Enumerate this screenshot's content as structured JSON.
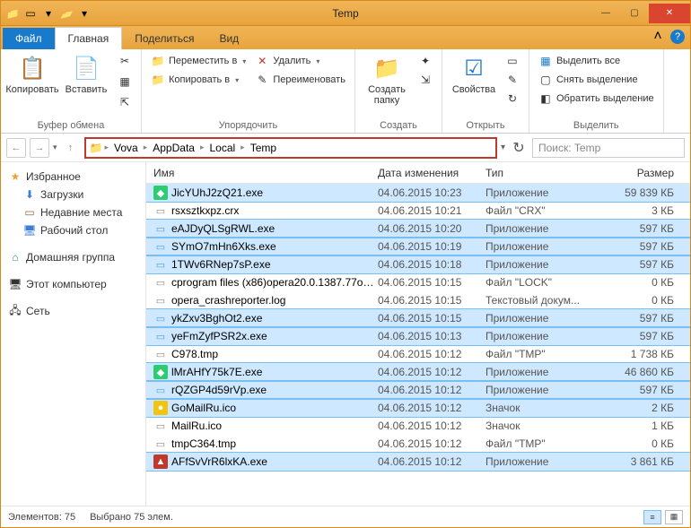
{
  "title": "Temp",
  "tabs": {
    "file": "Файл",
    "main": "Главная",
    "share": "Поделиться",
    "view": "Вид"
  },
  "ribbon": {
    "clipboard": {
      "copy": "Копировать",
      "paste": "Вставить",
      "label": "Буфер обмена"
    },
    "organize": {
      "moveTo": "Переместить в",
      "copyTo": "Копировать в",
      "delete": "Удалить",
      "rename": "Переименовать",
      "label": "Упорядочить"
    },
    "new": {
      "newFolder": "Создать папку",
      "label": "Создать"
    },
    "open": {
      "properties": "Свойства",
      "label": "Открыть"
    },
    "select": {
      "selectAll": "Выделить все",
      "selectNone": "Снять выделение",
      "invert": "Обратить выделение",
      "label": "Выделить"
    }
  },
  "breadcrumb": {
    "seg1": "Vova",
    "seg2": "AppData",
    "seg3": "Local",
    "seg4": "Temp"
  },
  "searchPlaceholder": "Поиск: Temp",
  "sidebar": {
    "favorites": "Избранное",
    "downloads": "Загрузки",
    "recent": "Недавние места",
    "desktop": "Рабочий стол",
    "homegroup": "Домашняя группа",
    "thispc": "Этот компьютер",
    "network": "Сеть"
  },
  "columns": {
    "name": "Имя",
    "date": "Дата изменения",
    "type": "Тип",
    "size": "Размер"
  },
  "files": [
    {
      "ic": "green",
      "name": "JicYUhJ2zQ21.exe",
      "date": "04.06.2015 10:23",
      "type": "Приложение",
      "size": "59 839 КБ",
      "sel": true
    },
    {
      "ic": "file",
      "name": "rsxsztkxpz.crx",
      "date": "04.06.2015 10:21",
      "type": "Файл \"CRX\"",
      "size": "3 КБ",
      "sel": false
    },
    {
      "ic": "app",
      "name": "eAJDyQLSgRWL.exe",
      "date": "04.06.2015 10:20",
      "type": "Приложение",
      "size": "597 КБ",
      "sel": true
    },
    {
      "ic": "app",
      "name": "SYmO7mHn6Xks.exe",
      "date": "04.06.2015 10:19",
      "type": "Приложение",
      "size": "597 КБ",
      "sel": true
    },
    {
      "ic": "app",
      "name": "1TWv6RNep7sP.exe",
      "date": "04.06.2015 10:18",
      "type": "Приложение",
      "size": "597 КБ",
      "sel": true
    },
    {
      "ic": "file",
      "name": "cprogram files (x86)opera20.0.1387.77ope...",
      "date": "04.06.2015 10:15",
      "type": "Файл \"LOCK\"",
      "size": "0 КБ",
      "sel": false
    },
    {
      "ic": "file",
      "name": "opera_crashreporter.log",
      "date": "04.06.2015 10:15",
      "type": "Текстовый докум...",
      "size": "0 КБ",
      "sel": false
    },
    {
      "ic": "app",
      "name": "ykZxv3BghOt2.exe",
      "date": "04.06.2015 10:15",
      "type": "Приложение",
      "size": "597 КБ",
      "sel": true
    },
    {
      "ic": "app",
      "name": "yeFmZyfPSR2x.exe",
      "date": "04.06.2015 10:13",
      "type": "Приложение",
      "size": "597 КБ",
      "sel": true
    },
    {
      "ic": "file",
      "name": "C978.tmp",
      "date": "04.06.2015 10:12",
      "type": "Файл \"TMP\"",
      "size": "1 738 КБ",
      "sel": false
    },
    {
      "ic": "green",
      "name": "lMrAHfY75k7E.exe",
      "date": "04.06.2015 10:12",
      "type": "Приложение",
      "size": "46 860 КБ",
      "sel": true
    },
    {
      "ic": "app",
      "name": "rQZGP4d59rVp.exe",
      "date": "04.06.2015 10:12",
      "type": "Приложение",
      "size": "597 КБ",
      "sel": true
    },
    {
      "ic": "yellow",
      "name": "GoMailRu.ico",
      "date": "04.06.2015 10:12",
      "type": "Значок",
      "size": "2 КБ",
      "sel": true
    },
    {
      "ic": "file",
      "name": "MailRu.ico",
      "date": "04.06.2015 10:12",
      "type": "Значок",
      "size": "1 КБ",
      "sel": false
    },
    {
      "ic": "file",
      "name": "tmpC364.tmp",
      "date": "04.06.2015 10:12",
      "type": "Файл \"TMP\"",
      "size": "0 КБ",
      "sel": false
    },
    {
      "ic": "red",
      "name": "AFfSvVrR6lxKA.exe",
      "date": "04.06.2015 10:12",
      "type": "Приложение",
      "size": "3 861 КБ",
      "sel": true
    }
  ],
  "status": {
    "items": "Элементов: 75",
    "selected": "Выбрано 75 элем."
  }
}
